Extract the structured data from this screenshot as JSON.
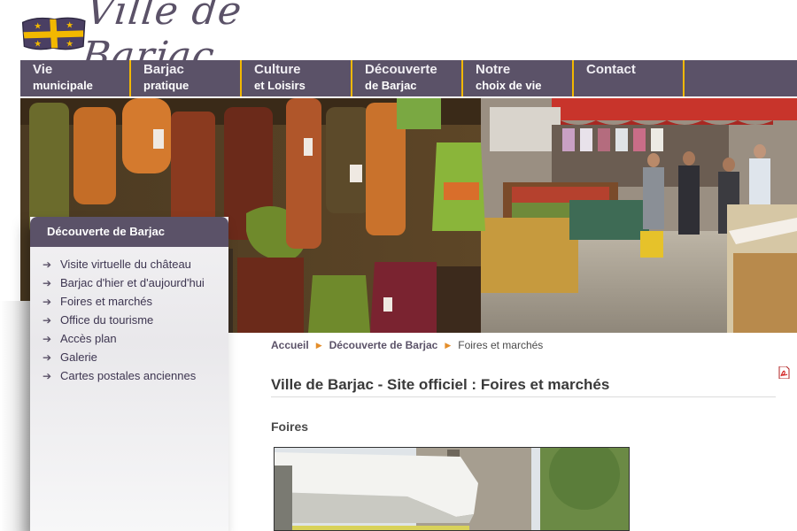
{
  "site": {
    "logo_text": "Ville de Barjac"
  },
  "nav": {
    "items": [
      {
        "line1": "Vie",
        "line2": "municipale"
      },
      {
        "line1": "Barjac",
        "line2": "pratique"
      },
      {
        "line1": "Culture",
        "line2": "et Loisirs"
      },
      {
        "line1": "Découverte",
        "line2": "de Barjac"
      },
      {
        "line1": "Notre",
        "line2": "choix de vie"
      },
      {
        "line1": "Contact",
        "line2": ""
      }
    ]
  },
  "sidebar": {
    "title": "Découverte de Barjac",
    "items": [
      {
        "label": "Visite virtuelle du château"
      },
      {
        "label": "Barjac d'hier et d'aujourd'hui"
      },
      {
        "label": "Foires et marchés"
      },
      {
        "label": "Office du tourisme"
      },
      {
        "label": "Accès plan"
      },
      {
        "label": "Galerie"
      },
      {
        "label": "Cartes postales anciennes"
      }
    ]
  },
  "breadcrumb": {
    "items": [
      "Accueil",
      "Découverte de Barjac",
      "Foires et marchés"
    ]
  },
  "content": {
    "page_title": "Ville de Barjac - Site officiel : Foires et marchés",
    "section_heading": "Foires"
  },
  "colors": {
    "nav_bg": "#5b5268",
    "nav_separator": "#f2b800",
    "breadcrumb_arrow": "#e48d2a"
  },
  "icons": {
    "pdf": "pdf-icon",
    "menu_arrow": "arrow-right-icon",
    "breadcrumb_separator": "triangle-right-icon"
  }
}
